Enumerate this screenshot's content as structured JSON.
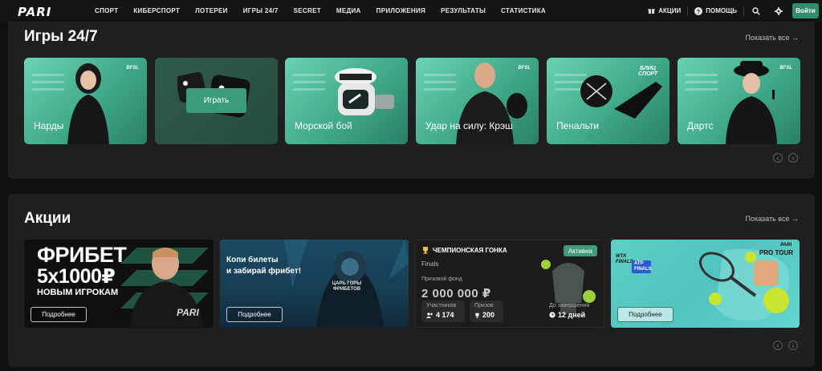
{
  "header": {
    "logo": "PARI",
    "nav": [
      "СПОРТ",
      "КИБЕРСПОРТ",
      "ЛОТЕРЕИ",
      "ИГРЫ 24/7",
      "SECRET",
      "МЕДИА",
      "ПРИЛОЖЕНИЯ",
      "РЕЗУЛЬТАТЫ",
      "СТАТИСТИКА"
    ],
    "promotions": "АКЦИИ",
    "help": "ПОМОЩЬ",
    "login": "Войти"
  },
  "games": {
    "title": "Игры 24/7",
    "show_all": "Показать все →",
    "play_label": "Играть",
    "cards": [
      {
        "label": "Нарды",
        "brand": "BFSL"
      },
      {
        "label": "",
        "brand": ""
      },
      {
        "label": "Морской бой",
        "brand": ""
      },
      {
        "label": "Удар на силу: Крэш",
        "brand": "BFSL"
      },
      {
        "label": "Пенальти",
        "brand": "БЛИЦ СПОРТ"
      },
      {
        "label": "Дартс",
        "brand": "BFSL"
      }
    ]
  },
  "promos": {
    "title": "Акции",
    "show_all": "Показать все →",
    "details_label": "Подробнее",
    "freebet": {
      "line1": "ФРИБЕТ",
      "line2": "5x1000₽",
      "line3": "НОВЫМ ИГРОКАМ",
      "brand": "PARI"
    },
    "tickets": {
      "text_line1": "Копи билеты",
      "text_line2": "и забирай фрибет!",
      "art_text": "ЦАРЬ ГОРЫ ФРИБЕТОВ"
    },
    "race": {
      "title": "ЧЕМПИОНСКАЯ ГОНКА",
      "status": "Активна",
      "subtitle": "Finals",
      "fund_label": "Призовой фонд",
      "fund": "2 000 000 ₽",
      "participants_label": "Участников",
      "participants": "4 174",
      "prizes_label": "Призов",
      "prizes": "200",
      "until_label": "До завершения",
      "until": "12 дней"
    },
    "tour": {
      "brand_top": "PARI",
      "brand_bottom": "PRO TOUR",
      "wta": "WTA FINALS",
      "atp": "ATP FINALS"
    }
  },
  "colors": {
    "accent": "#2e8f6a",
    "card_teal": "#4fbf9f",
    "panel": "#1f1f1f",
    "background": "#101010"
  }
}
